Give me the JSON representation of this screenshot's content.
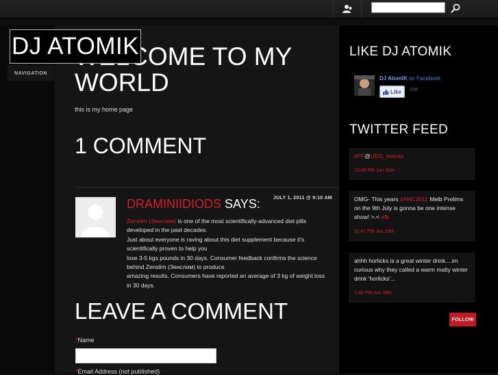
{
  "topbar": {
    "search": {
      "value": "",
      "placeholder": ""
    }
  },
  "logo": "DJ ATOMIK",
  "navigation_label": "NAVIGATION",
  "page": {
    "title": "WELCOME TO MY WORLD",
    "text": "this is my home page"
  },
  "comments": {
    "title": "1 COMMENT",
    "items": [
      {
        "author": "DRAMINIIDIODS",
        "says": " SAYS:",
        "date": "JULY 1, 2011 @ 9:10 AM",
        "link_text": "Zenslim (Зенслим)",
        "lines": [
          " is one of the most scientifically-advanced diet pills developed in the past decades.",
          "Just about everyone is raving about this diet supplement because it's scientifically proven to help you",
          "lose 3-5 kgs pounds in 30 days. Consumer feedback confirms the science behind Zenslim (Зенслим) to produce",
          "amazing results. Consumers have reported an average of 3 kg of weight loss in 30 days."
        ]
      }
    ]
  },
  "leave_comment": {
    "title": "LEAVE A COMMENT",
    "name_label": "Name",
    "email_label": "Email Address (not published)",
    "required_mark": "*"
  },
  "sidebar": {
    "like_title": "LIKE DJ ATOMIK",
    "facebook": {
      "page_name": "DJ AtomiK",
      "suffix": " on Facebook",
      "like_label": "Like",
      "count": "208"
    },
    "twitter_title": "TWITTER FEED",
    "tweets": [
      {
        "hash": "#FF",
        "at": "@",
        "handle": "UEG_events",
        "time": "10:49 PM Jun 30th"
      },
      {
        "text_a": "OMG- This years ",
        "tag": "#AHC2011",
        "text_b": " Melb Prelims on the 9th July is gonna be one intense show! >.< ",
        "tag2": "#fb",
        "time": "11:47 PM Jun 29th"
      },
      {
        "text": "ahhh horlicks is a great winter drink....im curious why they called a warm malty winter drink 'horlicks'...",
        "time": "1:30 PM Jun 29th"
      }
    ],
    "follow_label": "FOLLOW"
  },
  "colors": {
    "accent": "#d4202c",
    "background": "#0e0e0e"
  }
}
